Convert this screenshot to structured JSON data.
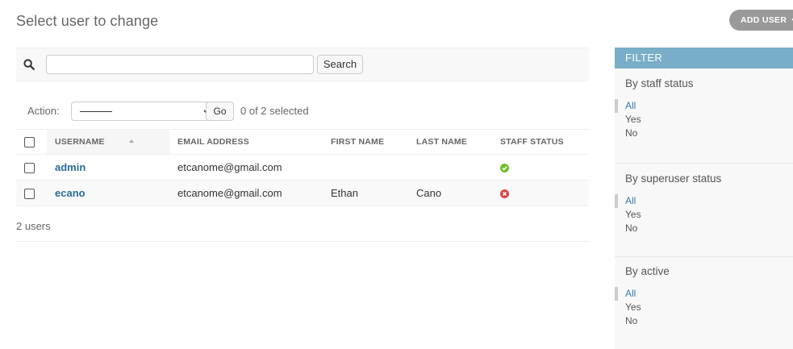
{
  "page": {
    "title": "Select user to change"
  },
  "add_user": {
    "label": "ADD USER",
    "icon": "plus-icon"
  },
  "search": {
    "value": "",
    "placeholder": "",
    "button": "Search",
    "icon": "search-icon"
  },
  "actions": {
    "label": "Action:",
    "selected_option": "---------",
    "go": "Go",
    "selected_count": "0 of 2 selected"
  },
  "table": {
    "columns": [
      "USERNAME",
      "EMAIL ADDRESS",
      "FIRST NAME",
      "LAST NAME",
      "STAFF STATUS"
    ],
    "rows": [
      {
        "username": "admin",
        "email": "etcanome@gmail.com",
        "first_name": "",
        "last_name": "",
        "staff_status": "yes"
      },
      {
        "username": "ecano",
        "email": "etcanome@gmail.com",
        "first_name": "Ethan",
        "last_name": "Cano",
        "staff_status": "no"
      }
    ]
  },
  "paginator": {
    "text": "2 users"
  },
  "filter": {
    "title": "FILTER",
    "groups": [
      {
        "heading": "By staff status",
        "options": [
          "All",
          "Yes",
          "No"
        ],
        "active": "All"
      },
      {
        "heading": "By superuser status",
        "options": [
          "All",
          "Yes",
          "No"
        ],
        "active": "All"
      },
      {
        "heading": "By active",
        "options": [
          "All",
          "Yes",
          "No"
        ],
        "active": "All"
      }
    ]
  },
  "colors": {
    "link": "#2b6d97",
    "filter_header": "#79aec8",
    "status_yes": "#70bf2b",
    "status_no": "#dd4646",
    "add_button": "#999999"
  }
}
